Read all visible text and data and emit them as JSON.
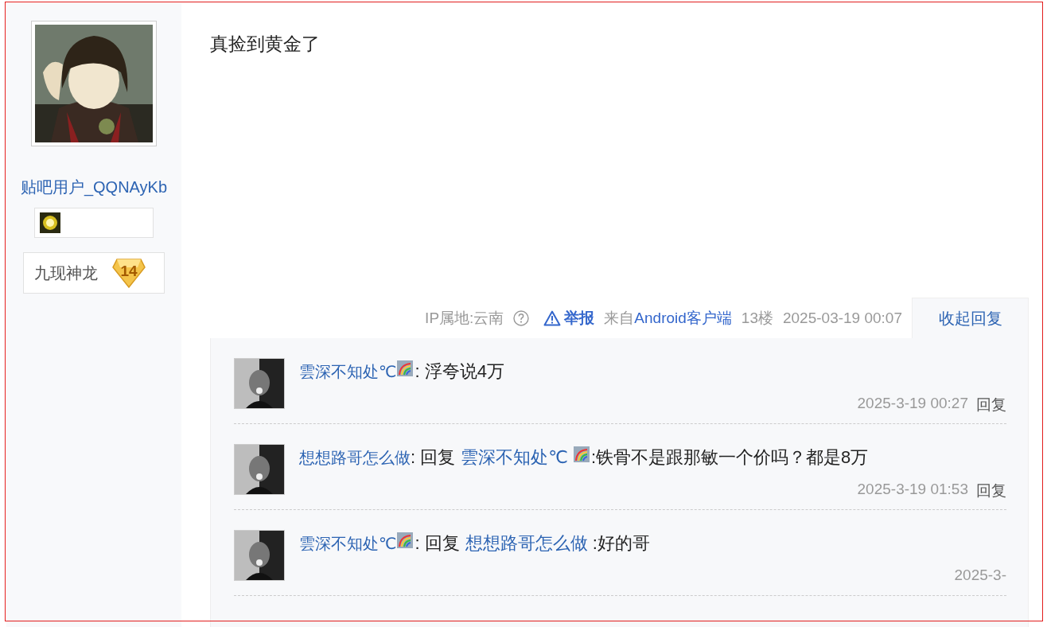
{
  "author": {
    "name": "贴吧用户_QQNAyKb",
    "title": "九现神龙",
    "level": "14"
  },
  "post": {
    "content": "真捡到黄金了",
    "ip": "IP属地:云南",
    "report": "举报",
    "source_prefix": "来自",
    "source": "Android客户端",
    "floor": "13楼",
    "time": "2025-03-19 00:07",
    "toggle": "收起回复"
  },
  "replies": [
    {
      "kind": "comment",
      "user": "雲深不知处℃",
      "user_badge": true,
      "text": ": 浮夸说4万",
      "time": "2025-3-19 00:27",
      "action": "回复"
    },
    {
      "kind": "reply",
      "user": "想想路哥怎么做",
      "user_badge": false,
      "lead": ": 回复",
      "target": "雲深不知处℃",
      "target_badge": true,
      "text": ":铁骨不是跟那敏一个价吗？都是8万",
      "time": "2025-3-19 01:53",
      "action": "回复"
    },
    {
      "kind": "reply",
      "user": "雲深不知处℃",
      "user_badge": true,
      "lead": ": 回复",
      "target": "想想路哥怎么做",
      "target_badge": false,
      "text": ":好的哥",
      "time": "2025-3-"
    }
  ]
}
